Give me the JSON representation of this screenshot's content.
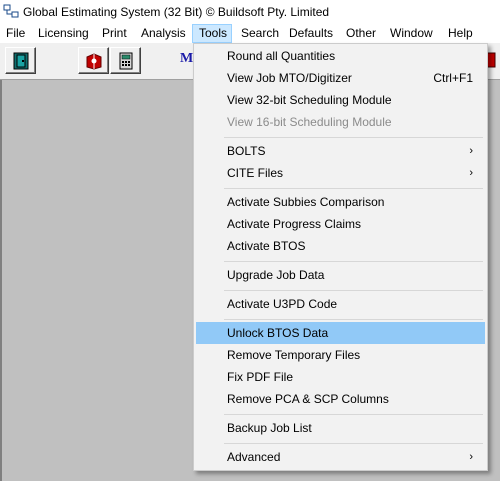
{
  "window": {
    "title": "Global Estimating System (32 Bit) © Buildsoft Pty. Limited"
  },
  "menubar": {
    "items": [
      {
        "label": "File"
      },
      {
        "label": "Licensing"
      },
      {
        "label": "Print"
      },
      {
        "label": "Analysis"
      },
      {
        "label": "Tools",
        "active": true
      },
      {
        "label": "Search"
      },
      {
        "label": "Defaults"
      },
      {
        "label": "Other"
      },
      {
        "label": "Window"
      },
      {
        "label": "Help"
      }
    ]
  },
  "toolbar": {
    "buttons": [
      {
        "icon": "door-exit-icon"
      },
      {
        "icon": "red-book-icon"
      },
      {
        "icon": "calculator-icon"
      }
    ],
    "partial_text": "M"
  },
  "tools_menu": {
    "items": [
      {
        "label": "Round all Quantities"
      },
      {
        "label": "View Job MTO/Digitizer",
        "shortcut": "Ctrl+F1"
      },
      {
        "label": "View 32-bit Scheduling Module"
      },
      {
        "label": "View 16-bit Scheduling Module",
        "disabled": true
      },
      {
        "label": "BOLTS",
        "submenu": true
      },
      {
        "label": "CITE Files",
        "submenu": true
      },
      {
        "label": "Activate Subbies Comparison"
      },
      {
        "label": "Activate Progress Claims"
      },
      {
        "label": "Activate BTOS"
      },
      {
        "label": "Upgrade Job Data"
      },
      {
        "label": "Activate U3PD Code"
      },
      {
        "label": "Unlock BTOS Data",
        "highlighted": true
      },
      {
        "label": "Remove Temporary Files"
      },
      {
        "label": "Fix PDF File"
      },
      {
        "label": "Remove PCA & SCP Columns"
      },
      {
        "label": "Backup Job List"
      },
      {
        "label": "Advanced",
        "submenu": true
      }
    ],
    "submenu_arrow": "›"
  },
  "colors": {
    "menu_bg": "#f2f2f2",
    "highlight": "#91c9f7",
    "active_menu": "#cce8ff",
    "mdi_bg": "#c0c0c0",
    "disabled_text": "#8b8b8b"
  }
}
